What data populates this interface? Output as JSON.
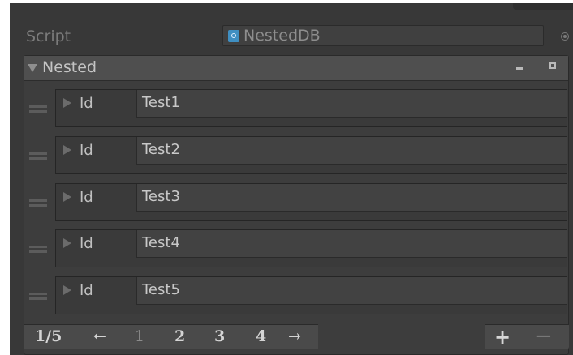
{
  "script": {
    "label": "Script",
    "value": "NestedDB"
  },
  "nested": {
    "title": "Nested",
    "collapse_all_label": "-",
    "expand_all_label": "+",
    "items": [
      {
        "label": "Id",
        "value": "Test1"
      },
      {
        "label": "Id",
        "value": "Test2"
      },
      {
        "label": "Id",
        "value": "Test3"
      },
      {
        "label": "Id",
        "value": "Test4"
      },
      {
        "label": "Id",
        "value": "Test5"
      }
    ]
  },
  "pager": {
    "page_indicator": "1/5",
    "prev": "←",
    "pages": [
      "1",
      "2",
      "3",
      "4"
    ],
    "next": "→",
    "current_page": 1
  },
  "list_controls": {
    "add": "+",
    "remove": "−"
  },
  "colors": {
    "background": "#383838",
    "header": "#4f4f4f",
    "accent": "#3f8fc2"
  }
}
